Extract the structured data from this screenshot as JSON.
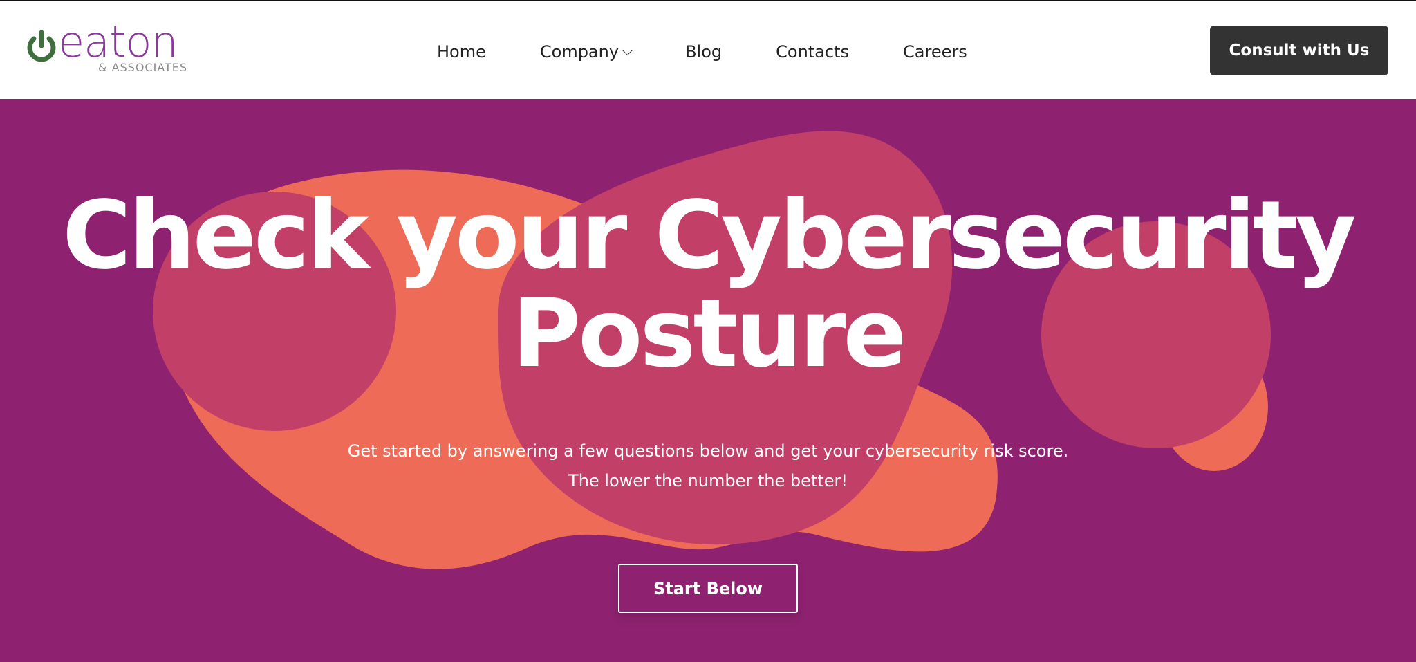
{
  "header": {
    "logo": {
      "word": "eaton",
      "sub": "& ASSOCIATES"
    },
    "nav": [
      {
        "label": "Home"
      },
      {
        "label": "Company"
      },
      {
        "label": "Blog"
      },
      {
        "label": "Contacts"
      },
      {
        "label": "Careers"
      }
    ],
    "cta_label": "Consult with Us"
  },
  "hero": {
    "title_line1": "Check your Cybersecurity",
    "title_line2": "Posture",
    "subtitle_line1": "Get started by answering a few questions below and get your cybersecurity risk score.",
    "subtitle_line2": "The lower the number the better!",
    "button_label": "Start Below"
  },
  "colors": {
    "hero_bg": "#8e2270",
    "blob_orange": "#ee6b58",
    "blob_pink": "#c23f68",
    "logo_purple": "#8a3a9a",
    "logo_green": "#3f6f3f",
    "cta_bg": "#333333"
  },
  "icons": {
    "logo_mark": "power-icon",
    "company_dropdown": "chevron-down-icon"
  }
}
